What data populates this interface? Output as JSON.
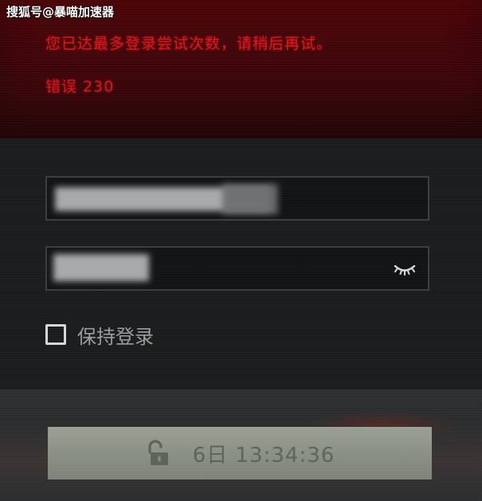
{
  "watermark": "搜狐号@暴喵加速器",
  "error": {
    "message": "您已达最多登录尝试次数，请稍后再试。",
    "code": "错误 230"
  },
  "form": {
    "username_icon": "blurred-username",
    "password_toggle_icon": "eye-closed-icon",
    "remember_label": "保持登录"
  },
  "login_button": {
    "icon": "unlock-icon",
    "countdown": "6日 13:34:36"
  },
  "colors": {
    "error_red": "#e0141b",
    "banner_bg": "#4a0508",
    "panel_bg": "#1b1c1e",
    "button_bg": "#8b9086"
  }
}
